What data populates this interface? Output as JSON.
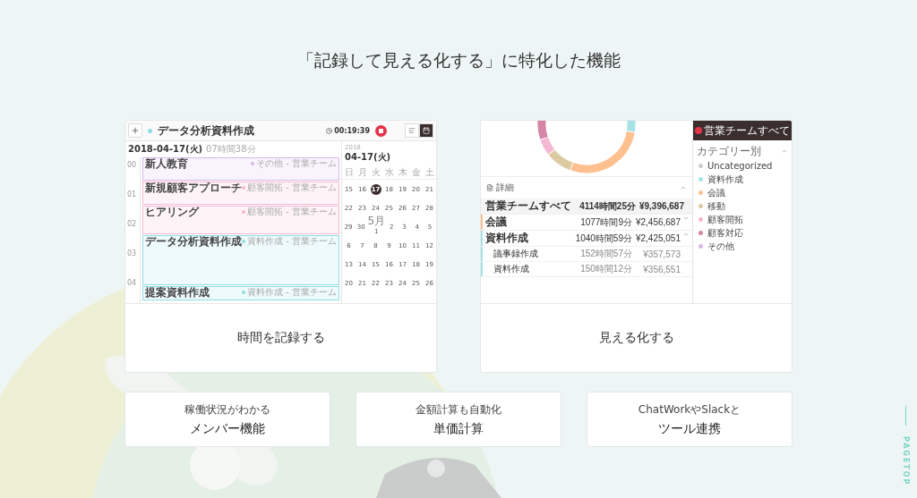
{
  "title": "「記録して見える化する」に特化した機能",
  "cards": [
    {
      "kind": "timer",
      "caption": "時間を記録する",
      "screenshot": {
        "toolbar": {
          "task": {
            "name": "データ分析資料作成",
            "color": "#8fdde3"
          },
          "elapsed": "00:19:39",
          "views": [
            {
              "kind": "list",
              "selected": false
            },
            {
              "kind": "calendar",
              "selected": true
            }
          ]
        },
        "day": {
          "date": "2018-04-17(火)",
          "total": "07時間38分",
          "hours": [
            "00",
            "01",
            "02",
            "03",
            "04"
          ],
          "entries": [
            {
              "name": "新人教育",
              "tag": "その他 - 営業チーム",
              "color": "#d7b8e8"
            },
            {
              "name": "新規顧客アプローチ",
              "tag": "顧客開拓 - 営業チーム",
              "color": "#f5b8d2"
            },
            {
              "name": "ヒアリング",
              "tag": "顧客開拓 - 営業チーム",
              "color": "#f5b8d2"
            },
            {
              "name": "データ分析資料作成",
              "tag": "資料作成 - 営業チーム",
              "color": "#8fdde3"
            },
            {
              "name": "提案資料作成",
              "tag": "資料作成 - 営業チーム",
              "color": "#8fdde3"
            }
          ]
        },
        "calendar": {
          "year": "2018",
          "date": "04-17(火)",
          "weekdays": [
            "日",
            "月",
            "火",
            "水",
            "木",
            "金",
            "土"
          ],
          "weeks": [
            [
              {
                "day": "15",
                "selected": false
              },
              {
                "day": "16",
                "selected": false
              },
              {
                "day": "17",
                "selected": true
              },
              {
                "day": "18",
                "selected": false
              },
              {
                "day": "19",
                "selected": false
              },
              {
                "day": "20",
                "selected": false
              },
              {
                "day": "21",
                "selected": false
              }
            ],
            [
              {
                "day": "22",
                "selected": false
              },
              {
                "day": "23",
                "selected": false
              },
              {
                "day": "24",
                "selected": false
              },
              {
                "day": "25",
                "selected": false
              },
              {
                "day": "26",
                "selected": false
              },
              {
                "day": "27",
                "selected": false
              },
              {
                "day": "28",
                "selected": false
              }
            ],
            [
              {
                "day": "29",
                "selected": false
              },
              {
                "day": "30",
                "selected": false
              },
              {
                "day": "1",
                "note": "5月",
                "selected": false
              },
              {
                "day": "2",
                "selected": false
              },
              {
                "day": "3",
                "selected": false
              },
              {
                "day": "4",
                "selected": false
              },
              {
                "day": "5",
                "selected": false
              }
            ],
            [
              {
                "day": "6",
                "selected": false
              },
              {
                "day": "7",
                "selected": false
              },
              {
                "day": "8",
                "selected": false
              },
              {
                "day": "9",
                "selected": false
              },
              {
                "day": "10",
                "selected": false
              },
              {
                "day": "11",
                "selected": false
              },
              {
                "day": "12",
                "selected": false
              }
            ],
            [
              {
                "day": "13",
                "selected": false
              },
              {
                "day": "14",
                "selected": false
              },
              {
                "day": "15",
                "selected": false
              },
              {
                "day": "16",
                "selected": false
              },
              {
                "day": "17",
                "selected": false
              },
              {
                "day": "18",
                "selected": false
              },
              {
                "day": "19",
                "selected": false
              }
            ],
            [
              {
                "day": "20",
                "selected": false
              },
              {
                "day": "21",
                "selected": false
              },
              {
                "day": "22",
                "selected": false
              },
              {
                "day": "23",
                "selected": false
              },
              {
                "day": "24",
                "selected": false
              },
              {
                "day": "25",
                "selected": false
              },
              {
                "day": "26",
                "selected": false
              }
            ]
          ]
        }
      }
    },
    {
      "kind": "report",
      "caption": "見える化する",
      "screenshot": {
        "details": {
          "title": "詳細",
          "expanded": true,
          "total": {
            "name": "営業チームすべて",
            "time": "4114時間25分",
            "amount": "¥9,396,687"
          },
          "rows": [
            {
              "name": "会議",
              "time": "1077時間9分",
              "amount": "¥2,456,687",
              "color": "#ffc090",
              "expanded": false,
              "children": []
            },
            {
              "name": "資料作成",
              "time": "1040時間59分",
              "amount": "¥2,425,051",
              "color": "#a5e3e6",
              "expanded": true,
              "children": [
                {
                  "name": "議事録作成",
                  "time": "152時間57分",
                  "amount": "¥357,573"
                },
                {
                  "name": "資料作成",
                  "time": "150時間12分",
                  "amount": "¥356,551"
                }
              ]
            }
          ]
        },
        "sidebar": {
          "team": "営業チームすべて",
          "group": "カテゴリー別",
          "expanded": true,
          "categories": [
            {
              "name": "Uncategorized",
              "color": "#cccccc"
            },
            {
              "name": "資料作成",
              "color": "#a5e3e6"
            },
            {
              "name": "会議",
              "color": "#ffc090"
            },
            {
              "name": "移動",
              "color": "#dccba0"
            },
            {
              "name": "顧客開拓",
              "color": "#f5b8d2"
            },
            {
              "name": "顧客対応",
              "color": "#d585a5"
            },
            {
              "name": "その他",
              "color": "#d7b8e8"
            }
          ]
        }
      }
    }
  ],
  "features": [
    {
      "sub": "稼働状況がわかる",
      "main": "メンバー機能"
    },
    {
      "sub": "金額計算も自動化",
      "main": "単価計算"
    },
    {
      "sub": "ChatWorkやSlackと",
      "main": "ツール連携"
    }
  ],
  "pagetop": "PAGETOP"
}
